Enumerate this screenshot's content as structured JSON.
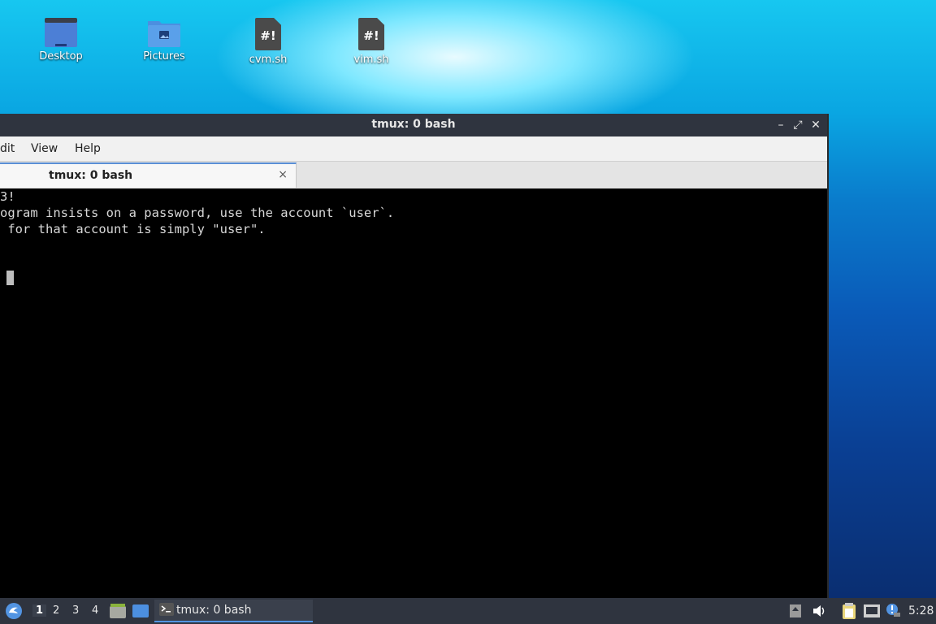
{
  "desktop": {
    "icons": [
      {
        "label": "Desktop",
        "icon": "desktop-folder-icon"
      },
      {
        "label": "Pictures",
        "icon": "pictures-folder-icon"
      },
      {
        "label": "cvm.sh",
        "icon": "script-file-icon"
      },
      {
        "label": "vim.sh",
        "icon": "script-file-icon"
      }
    ],
    "script_glyph": "#!"
  },
  "window": {
    "title": "tmux: 0 bash",
    "buttons": {
      "minimize": "–",
      "maximize": "⤢",
      "close": "✕"
    },
    "menu": [
      "dit",
      "View",
      "Help"
    ],
    "tab": {
      "label": "tmux: 0 bash",
      "close": "×"
    },
    "terminal_lines": [
      "3!",
      "ogram insists on a password, use the account `user`.",
      " for that account is simply \"user\"."
    ]
  },
  "taskbar": {
    "workspaces": [
      "1",
      "2",
      "3",
      "4"
    ],
    "active_workspace": "1",
    "task": {
      "label": "tmux: 0 bash",
      "icon": "terminal-icon"
    },
    "clock": "5:28",
    "colors": {
      "accent": "#5294e2",
      "panel": "#2f343f"
    }
  }
}
